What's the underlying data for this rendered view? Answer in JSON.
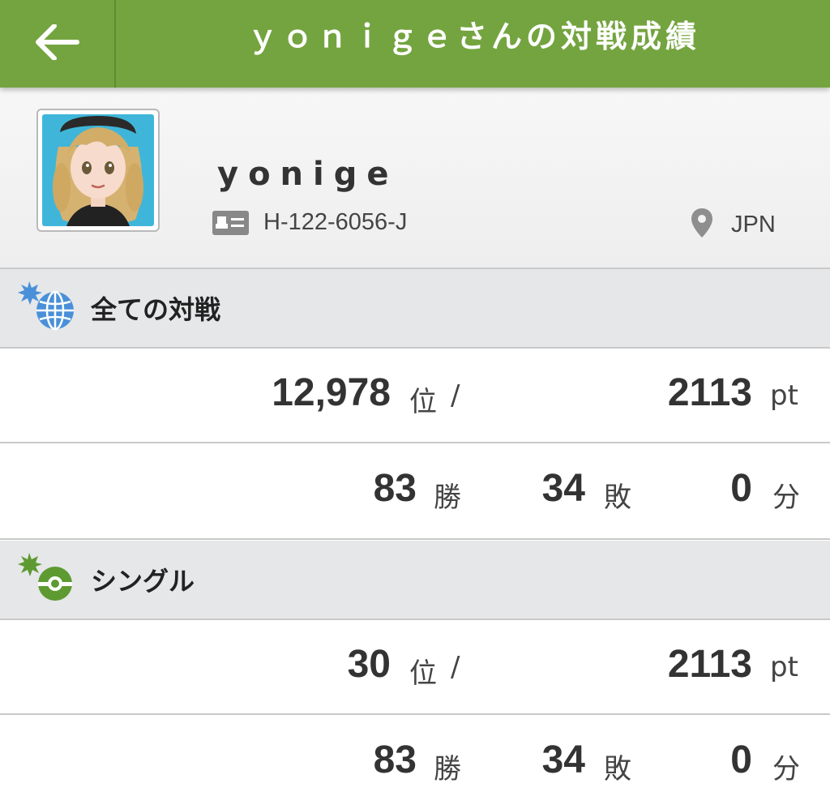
{
  "header": {
    "title": "ｙｏｎｉｇｅさんの対戦成績"
  },
  "icons": {
    "back": "back-arrow-icon",
    "trainer_id": "id-card-icon",
    "location": "location-pin-icon",
    "all_battles": "globe-burst-icon",
    "single": "pokeball-burst-icon"
  },
  "colors": {
    "header_bg": "#74a43f",
    "icon_blue": "#4a90d9",
    "icon_green": "#5e9a32"
  },
  "profile": {
    "username": "yonige",
    "trainer_id": "H-122-6056-J",
    "region": "JPN"
  },
  "sections": [
    {
      "title": "全ての対戦",
      "rank": "12,978",
      "rank_unit": "位",
      "slash": "/",
      "points": "2113",
      "points_unit": "pt",
      "wins": "83",
      "wins_unit": "勝",
      "losses": "34",
      "losses_unit": "敗",
      "draws": "0",
      "draws_unit": "分"
    },
    {
      "title": "シングル",
      "rank": "30",
      "rank_unit": "位",
      "slash": "/",
      "points": "2113",
      "points_unit": "pt",
      "wins": "83",
      "wins_unit": "勝",
      "losses": "34",
      "losses_unit": "敗",
      "draws": "0",
      "draws_unit": "分"
    }
  ]
}
